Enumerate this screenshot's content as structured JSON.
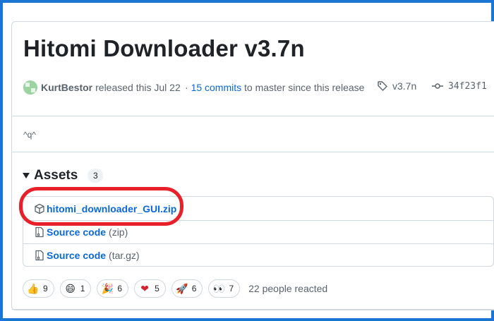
{
  "release": {
    "title": "Hitomi Downloader v3.7n",
    "author": "KurtBestor",
    "released_text": "released this Jul 22",
    "commits_prefix": "·",
    "commits_link": "15 commits",
    "commits_suffix": "to master since this release",
    "tag": "v3.7n",
    "commit_hash": "34f23f1",
    "body": "^q^"
  },
  "assets": {
    "title": "Assets",
    "count": "3",
    "items": [
      {
        "name": "hitomi_downloader_GUI.zip",
        "ext": "",
        "icon": "package-icon"
      },
      {
        "name": "Source code",
        "ext": "(zip)",
        "icon": "file-zip-icon"
      },
      {
        "name": "Source code",
        "ext": "(tar.gz)",
        "icon": "file-zip-icon"
      }
    ]
  },
  "reactions": {
    "items": [
      {
        "emoji": "👍",
        "count": "9",
        "icon": "thumbs-up-icon"
      },
      {
        "emoji": "😄",
        "count": "1",
        "icon": "laugh-icon"
      },
      {
        "emoji": "🎉",
        "count": "6",
        "icon": "hooray-icon"
      },
      {
        "emoji": "❤",
        "count": "5",
        "icon": "heart-icon"
      },
      {
        "emoji": "🚀",
        "count": "6",
        "icon": "rocket-icon"
      },
      {
        "emoji": "👀",
        "count": "7",
        "icon": "eyes-icon"
      }
    ],
    "summary": "22 people reacted"
  },
  "colors": {
    "frame": "#1a76d2",
    "link": "#0969da",
    "highlight": "#e8202a",
    "muted": "#59636e"
  }
}
